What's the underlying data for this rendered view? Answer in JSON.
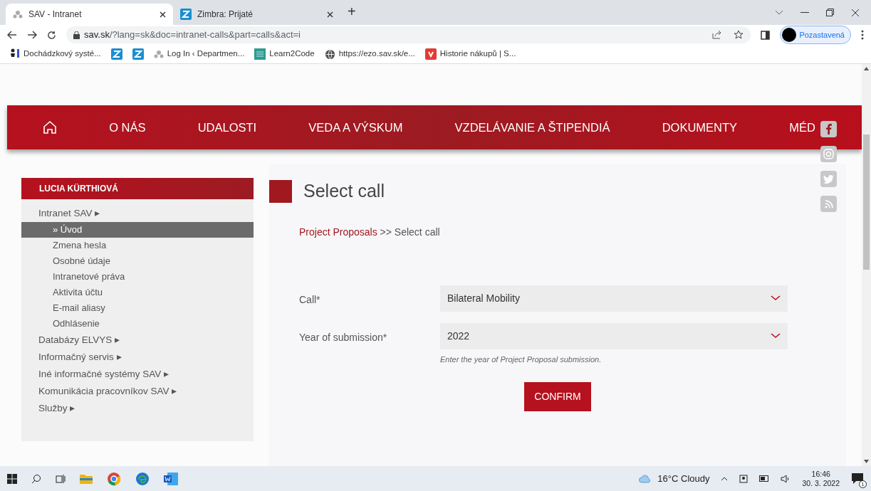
{
  "browser": {
    "tabs": [
      {
        "title": "SAV - Intranet",
        "selected": true,
        "kind": "sav"
      },
      {
        "title": "Zimbra: Prijaté",
        "selected": false,
        "kind": "z"
      }
    ],
    "tab_add": "+",
    "url_host": "sav.sk",
    "url_rest": "/?lang=sk&doc=intranet-calls&part=calls&act=i",
    "profile": "Pozastavená",
    "bookmarks": [
      {
        "title": "Dochádzkový systé...",
        "kind": "person"
      },
      {
        "kind": "z"
      },
      {
        "kind": "z"
      },
      {
        "title": "Log In ‹ Departmen...",
        "kind": "sav"
      },
      {
        "title": "Learn2Code",
        "kind": "grid"
      },
      {
        "title": "https://ezo.sav.sk/e...",
        "kind": "globe"
      },
      {
        "title": "Historie nákupů | S...",
        "kind": "red"
      }
    ]
  },
  "nav": {
    "items": [
      "O NÁS",
      "UDALOSTI",
      "VEDA A VÝSKUM",
      "VZDELÁVANIE A ŠTIPENDIÁ",
      "DOKUMENTY",
      "MÉD"
    ]
  },
  "sidebar": {
    "user": "LUCIA KÜRTHIOVÁ",
    "items": [
      {
        "label": "Intranet SAV ▸",
        "selected": false,
        "children": [
          {
            "label": "» Úvod",
            "selected": true
          },
          {
            "label": "Zmena hesla",
            "selected": false
          },
          {
            "label": "Osobné údaje",
            "selected": false
          },
          {
            "label": "Intranetové práva",
            "selected": false
          },
          {
            "label": "Aktivita účtu",
            "selected": false
          },
          {
            "label": "E-mail aliasy",
            "selected": false
          },
          {
            "label": "Odhlásenie",
            "selected": false
          }
        ]
      },
      {
        "label": "Databázy ELVYS ▸",
        "selected": false
      },
      {
        "label": "Informačný servis ▸",
        "selected": false
      },
      {
        "label": "Iné informačné systémy SAV ▸",
        "selected": false
      },
      {
        "label": "Komunikácia pracovníkov SAV ▸",
        "selected": false
      },
      {
        "label": "Služby ▸",
        "selected": false
      }
    ]
  },
  "content": {
    "title": "Select call",
    "breadcrumb_link": "Project Proposals",
    "breadcrumb_rest": ">> Select call",
    "fields": [
      {
        "label": "Call*",
        "value": "Bilateral Mobility",
        "kind": "select"
      },
      {
        "label": "Year of submission*",
        "value": "2022",
        "kind": "select",
        "hint": "Enter the year of Project Proposal submission."
      }
    ],
    "button": "CONFIRM"
  },
  "taskbar": {
    "weather": "16°C Cloudy",
    "time": "16:46",
    "date": "30. 3. 2022",
    "notifications": "1"
  }
}
